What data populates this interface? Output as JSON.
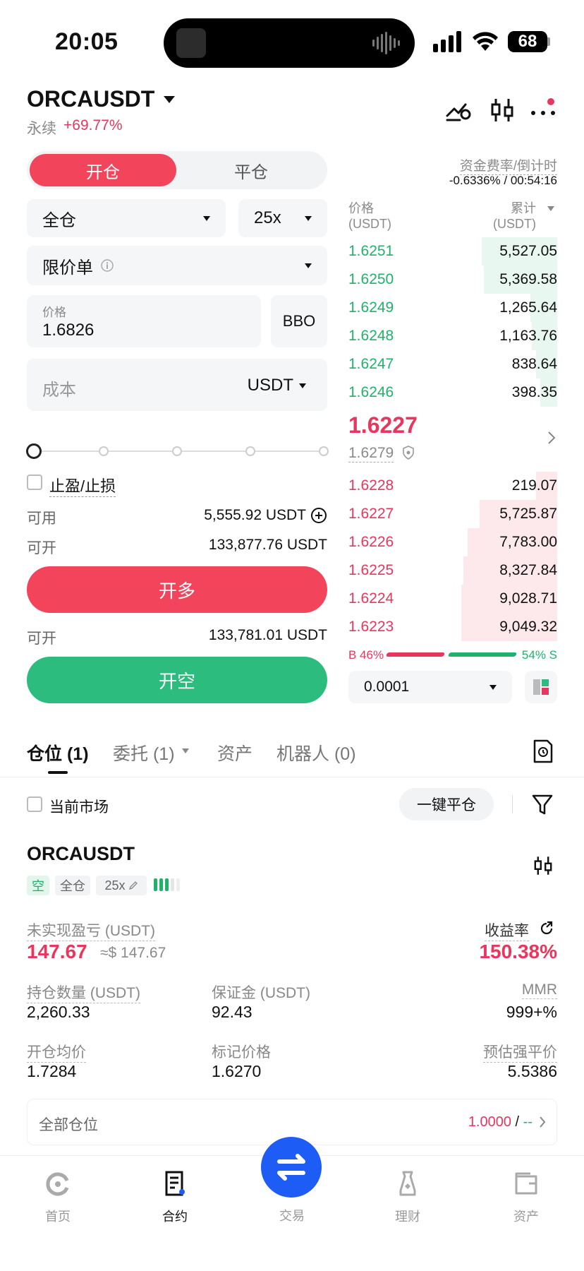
{
  "status": {
    "time": "20:05",
    "battery": "68"
  },
  "header": {
    "symbol": "ORCAUSDT",
    "perp_label": "永续",
    "change": "+69.77%"
  },
  "form": {
    "tab_open": "开仓",
    "tab_close": "平仓",
    "margin_mode": "全仓",
    "leverage": "25x",
    "order_type": "限价单",
    "price_label": "价格",
    "price_value": "1.6826",
    "bbo_label": "BBO",
    "cost_placeholder": "成本",
    "cost_unit": "USDT",
    "tpsl_label": "止盈/止损",
    "available_label": "可用",
    "available_value": "5,555.92 USDT",
    "open_label_1": "可开",
    "open_value_1": "133,877.76 USDT",
    "long_button": "开多",
    "open_label_2": "可开",
    "open_value_2": "133,781.01 USDT",
    "short_button": "开空"
  },
  "orderbook": {
    "funding_label": "资金费率/倒计时",
    "funding_value": "-0.6336% / 00:54:16",
    "price_col": "价格",
    "price_unit": "(USDT)",
    "total_col": "累计",
    "total_unit": "(USDT)",
    "asks": [
      {
        "price": "1.6251",
        "qty": "5,527.05",
        "depth": 0.36
      },
      {
        "price": "1.6250",
        "qty": "5,369.58",
        "depth": 0.35
      },
      {
        "price": "1.6249",
        "qty": "1,265.64",
        "depth": 0.13
      },
      {
        "price": "1.6248",
        "qty": "1,163.76",
        "depth": 0.12
      },
      {
        "price": "1.6247",
        "qty": "838.64",
        "depth": 0.1
      },
      {
        "price": "1.6246",
        "qty": "398.35",
        "depth": 0.08
      }
    ],
    "last_price": "1.6227",
    "mark_price": "1.6279",
    "bids": [
      {
        "price": "1.6228",
        "qty": "219.07",
        "depth": 0.1
      },
      {
        "price": "1.6227",
        "qty": "5,725.87",
        "depth": 0.37
      },
      {
        "price": "1.6226",
        "qty": "7,783.00",
        "depth": 0.43
      },
      {
        "price": "1.6225",
        "qty": "8,327.84",
        "depth": 0.45
      },
      {
        "price": "1.6224",
        "qty": "9,028.71",
        "depth": 0.46
      },
      {
        "price": "1.6223",
        "qty": "9,049.32",
        "depth": 0.46
      }
    ],
    "buy_ratio_label": "B 46%",
    "sell_ratio_label": "54% S",
    "buy_ratio": 0.46,
    "precision": "0.0001"
  },
  "positions": {
    "tabs": [
      {
        "label": "仓位",
        "count": "(1)"
      },
      {
        "label": "委托",
        "count": "(1)"
      },
      {
        "label": "资产",
        "count": ""
      },
      {
        "label": "机器人",
        "count": "(0)"
      }
    ],
    "current_market_label": "当前市场",
    "close_all_button": "一键平仓",
    "card": {
      "symbol": "ORCAUSDT",
      "side": "空",
      "margin_mode": "全仓",
      "leverage": "25x",
      "pnl_label": "未实现盈亏 (USDT)",
      "pnl_value": "147.67",
      "pnl_usd": "≈$ 147.67",
      "roe_label": "收益率",
      "roe_value": "150.38%",
      "size_label": "持仓数量 (USDT)",
      "size_value": "2,260.33",
      "margin_label": "保证金 (USDT)",
      "margin_value": "92.43",
      "mmr_label": "MMR",
      "mmr_value": "999+%",
      "entry_label": "开仓均价",
      "entry_value": "1.7284",
      "mark_label": "标记价格",
      "mark_value": "1.6270",
      "liq_label": "预估强平价",
      "liq_value": "5.5386"
    },
    "all_positions_label": "全部仓位",
    "all_positions_value": "1.0000",
    "all_positions_sep": "/",
    "all_positions_extra": "--"
  },
  "nav": {
    "items": [
      {
        "label": "首页"
      },
      {
        "label": "合约"
      },
      {
        "label": "交易"
      },
      {
        "label": "理财"
      },
      {
        "label": "资产"
      }
    ]
  },
  "colors": {
    "green": "#20b26c",
    "red": "#e8365d",
    "accent": "#1e5cf6"
  }
}
